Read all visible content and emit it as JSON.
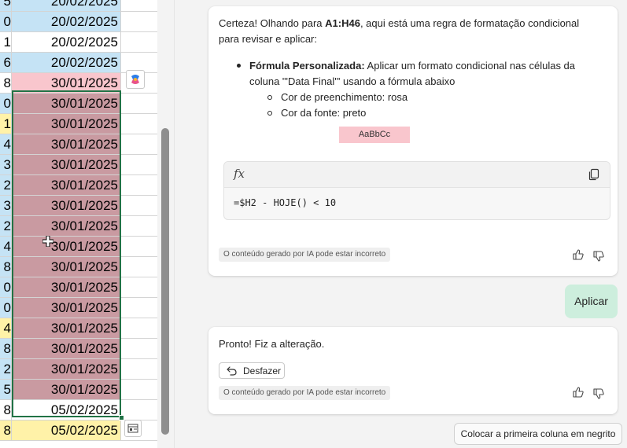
{
  "sheet": {
    "rows": [
      {
        "a": "5",
        "b": "20/02/2025",
        "a_color": "blue",
        "b_color": "blue"
      },
      {
        "a": "0",
        "b": "20/02/2025",
        "a_color": "blue",
        "b_color": "blue"
      },
      {
        "a": "1",
        "b": "20/02/2025",
        "a_color": "white",
        "b_color": "white"
      },
      {
        "a": "6",
        "b": "20/02/2025",
        "a_color": "blue",
        "b_color": "blue"
      },
      {
        "a": "8",
        "b": "30/01/2025",
        "a_color": "white",
        "b_color": "pinklight"
      },
      {
        "a": "0",
        "b": "30/01/2025",
        "a_color": "blue",
        "b_color": "pinkdark"
      },
      {
        "a": "1",
        "b": "30/01/2025",
        "a_color": "yellow",
        "b_color": "pinkdark"
      },
      {
        "a": "4",
        "b": "30/01/2025",
        "a_color": "blue",
        "b_color": "pinkdark"
      },
      {
        "a": "3",
        "b": "30/01/2025",
        "a_color": "blue",
        "b_color": "pinkdark"
      },
      {
        "a": "2",
        "b": "30/01/2025",
        "a_color": "blue",
        "b_color": "pinkdark"
      },
      {
        "a": "3",
        "b": "30/01/2025",
        "a_color": "blue",
        "b_color": "pinkdark"
      },
      {
        "a": "2",
        "b": "30/01/2025",
        "a_color": "blue",
        "b_color": "pinkdark"
      },
      {
        "a": "4",
        "b": "30/01/2025",
        "a_color": "blue",
        "b_color": "pinkdark"
      },
      {
        "a": "8",
        "b": "30/01/2025",
        "a_color": "blue",
        "b_color": "pinkdark"
      },
      {
        "a": "0",
        "b": "30/01/2025",
        "a_color": "blue",
        "b_color": "pinkdark"
      },
      {
        "a": "0",
        "b": "30/01/2025",
        "a_color": "blue",
        "b_color": "pinkdark"
      },
      {
        "a": "4",
        "b": "30/01/2025",
        "a_color": "yellow",
        "b_color": "pinkdark"
      },
      {
        "a": "8",
        "b": "30/01/2025",
        "a_color": "blue",
        "b_color": "pinkdark"
      },
      {
        "a": "2",
        "b": "30/01/2025",
        "a_color": "blue",
        "b_color": "pinkdark"
      },
      {
        "a": "5",
        "b": "30/01/2025",
        "a_color": "blue",
        "b_color": "pinkdark"
      },
      {
        "a": "8",
        "b": "05/02/2025",
        "a_color": "white",
        "b_color": "white"
      },
      {
        "a": "8",
        "b": "05/02/2025",
        "a_color": "yellow",
        "b_color": "yellow"
      }
    ],
    "colors": {
      "blue": "#c5e3f5",
      "white": "#ffffff",
      "yellow": "#fff2a8",
      "pinklight": "#f9c6cd",
      "pinkdark": "#c99aa1",
      "selection": "#217346"
    },
    "icons": {
      "copilot_float": "copilot-icon",
      "quick_analysis": "quick-analysis-icon",
      "cursor": "cell-cursor-icon"
    }
  },
  "chat": {
    "message1": {
      "intro_1": "Certeza! Olhando para ",
      "intro_range": "A1:H46",
      "intro_2": ", aqui está uma regra de formatação condicional",
      "intro_line2": "para revisar e aplicar:",
      "bullet_title": "Fórmula Personalizada:",
      "bullet_text_1": " Aplicar um formato condicional nas células da",
      "bullet_text_2": "coluna \"'Data Final'\" usando a fórmula abaixo",
      "sub_items": [
        "Cor de preenchimento: rosa",
        "Cor da fonte: preto"
      ],
      "swatch_label": "AaBbCc",
      "code_header_icon": "fx",
      "code": "=$H2 - HOJE() < 10",
      "disclaimer": "O conteúdo gerado por IA pode estar incorreto"
    },
    "user_reply": "Aplicar",
    "message2": {
      "text": "Pronto! Fiz a alteração.",
      "undo_label": "Desfazer",
      "disclaimer": "O conteúdo gerado por IA pode estar incorreto"
    },
    "suggestion": "Colocar a primeira coluna em negrito"
  }
}
